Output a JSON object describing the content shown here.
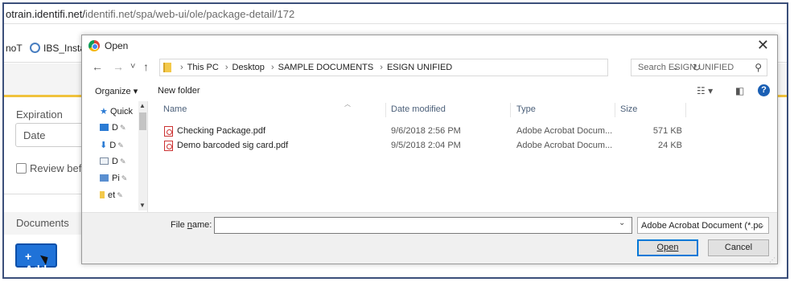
{
  "browser": {
    "url_prefix": "otrain.identifi.net/",
    "url_rest": "identifi.net/spa/web-ui/ole/package-detail/172",
    "bookmarks": [
      "noT",
      "IBS_Insta"
    ]
  },
  "page": {
    "expiration_label": "Expiration",
    "date_placeholder": "Date",
    "review_label": "Review befo",
    "documents_label": "Documents",
    "add_button": "+ Add"
  },
  "dialog": {
    "title": "Open",
    "close": "✕",
    "nav": {
      "back": "←",
      "forward": "→",
      "recent": "˅",
      "up": "↑"
    },
    "breadcrumb": [
      "This PC",
      "Desktop",
      "SAMPLE DOCUMENTS",
      "ESIGN UNIFIED"
    ],
    "search_placeholder": "Search ESIGN UNIFIED",
    "toolbar": {
      "organize": "Organize ▾",
      "new_folder": "New folder",
      "help": "?"
    },
    "tree": [
      {
        "label": "Quick",
        "icon": "star-icon",
        "color": "#2b7bd4"
      },
      {
        "label": "D",
        "icon": "desktop-icon",
        "color": "#2b7bd4"
      },
      {
        "label": "D",
        "icon": "download-icon",
        "color": "#2b7bd4"
      },
      {
        "label": "D",
        "icon": "document-icon",
        "color": "#7a8aa0"
      },
      {
        "label": "Pi",
        "icon": "pictures-icon",
        "color": "#5a8fd0"
      },
      {
        "label": "et",
        "icon": "folder-icon",
        "color": "#f3c94b"
      }
    ],
    "columns": [
      "Name",
      "Date modified",
      "Type",
      "Size"
    ],
    "files": [
      {
        "name": "Checking Package.pdf",
        "date": "9/6/2018 2:56 PM",
        "type": "Adobe Acrobat Docum...",
        "size": "571 KB"
      },
      {
        "name": "Demo barcoded sig card.pdf",
        "date": "9/5/2018 2:04 PM",
        "type": "Adobe Acrobat Docum...",
        "size": "24 KB"
      }
    ],
    "file_name_label": "File name:",
    "file_name_value": "",
    "file_type": "Adobe Acrobat Document (*.pc",
    "open_button": "Open",
    "cancel_button": "Cancel"
  }
}
